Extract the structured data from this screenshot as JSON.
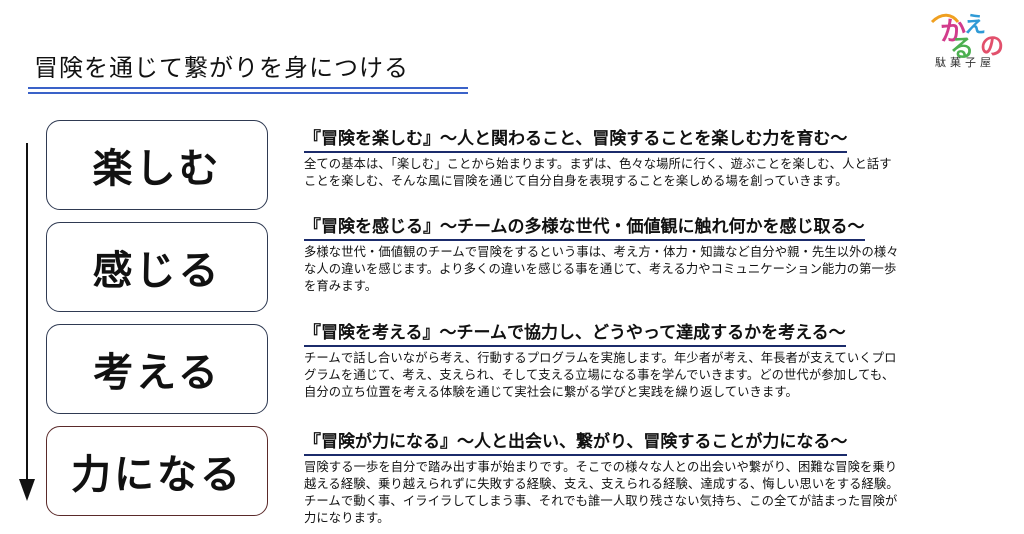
{
  "header": {
    "title": "冒険を通じて繋がりを身につける"
  },
  "logo": {
    "main_text": "かえるの",
    "sub_text": "駄菓子屋",
    "colors": [
      "#d23c8c",
      "#2f9ad6",
      "#f0a020",
      "#4caf50",
      "#e2506c"
    ]
  },
  "steps": [
    {
      "label": "楽しむ"
    },
    {
      "label": "感じる"
    },
    {
      "label": "考える"
    },
    {
      "label": "力になる"
    }
  ],
  "sections": [
    {
      "heading": "『冒険を楽しむ』～人と関わること、冒険することを楽しむ力を育む～",
      "lines": [
        "全ての基本は、「楽しむ」ことから始まります。まずは、色々な場所に行く、遊ぶことを楽しむ、人と話す",
        "ことを楽しむ、そんな風に冒険を通じて自分自身を表現することを楽しめる場を創っていきます。"
      ]
    },
    {
      "heading": "『冒険を感じる』～チームの多様な世代・価値観に触れ何かを感じ取る～",
      "lines": [
        "多様な世代・価値観のチームで冒険をするという事は、考え方・体力・知識など自分や親・先生以外の様々",
        "な人の違いを感じます。より多くの違いを感じる事を通じて、考える力やコミュニケーション能力の第一歩",
        "を育みます。"
      ]
    },
    {
      "heading": "『冒険を考える』～チームで協力し、どうやって達成するかを考える～",
      "lines": [
        "チームで話し合いながら考え、行動するプログラムを実施します。年少者が考え、年長者が支えていくプロ",
        "グラムを通じて、考え、支えられ、そして支える立場になる事を学んでいきます。どの世代が参加しても、",
        "自分の立ち位置を考える体験を通じて実社会に繋がる学びと実践を繰り返していきます。"
      ]
    },
    {
      "heading": "『冒険が力になる』～人と出会い、繋がり、冒険することが力になる～",
      "lines": [
        "冒険する一歩を自分で踏み出す事が始まりです。そこでの様々な人との出会いや繋がり、困難な冒険を乗り",
        "越える経験、乗り越えられずに失敗する経験、支え、支えられる経験、達成する、悔しい思いをする経験。",
        "チームで動く事、イライラしてしまう事、それでも誰一人取り残さない気持ち、この全てが詰まった冒険が",
        "力になります。"
      ]
    }
  ]
}
